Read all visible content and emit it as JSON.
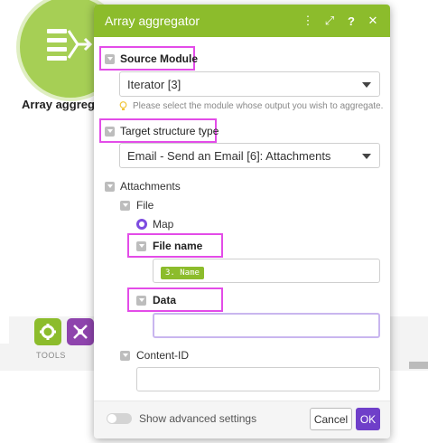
{
  "canvas": {
    "module_label": "Array aggrega",
    "tools_label": "TOOLS",
    "tool_icons": [
      "gear-icon",
      "flow-control-icon"
    ]
  },
  "dialog": {
    "title": "Array aggregator",
    "header_icons": [
      "more-vertical-icon",
      "expand-icon",
      "help-icon",
      "close-icon"
    ],
    "header_glyphs": {
      "more": "⋮",
      "expand": "⤢",
      "help": "?",
      "close": "✕"
    },
    "source_module": {
      "label": "Source Module",
      "value": "Iterator [3]",
      "hint": "Please select the module whose output you wish to aggregate."
    },
    "target_structure": {
      "label": "Target structure type",
      "value": "Email - Send an Email [6]: Attachments"
    },
    "attachments": {
      "label": "Attachments",
      "file": {
        "label": "File",
        "mode": "Map",
        "file_name": {
          "label": "File name",
          "token": "3. Name"
        },
        "data": {
          "label": "Data",
          "value": ""
        }
      },
      "content_id": {
        "label": "Content-ID",
        "value": ""
      }
    },
    "footer": {
      "advanced_label": "Show advanced settings",
      "cancel_label": "Cancel",
      "ok_label": "OK"
    }
  },
  "colors": {
    "header_green": "#8cbc2c",
    "highlight_pink": "#e34ce8",
    "primary_purple": "#6f3fc9",
    "token_green": "#8cbc2c"
  }
}
